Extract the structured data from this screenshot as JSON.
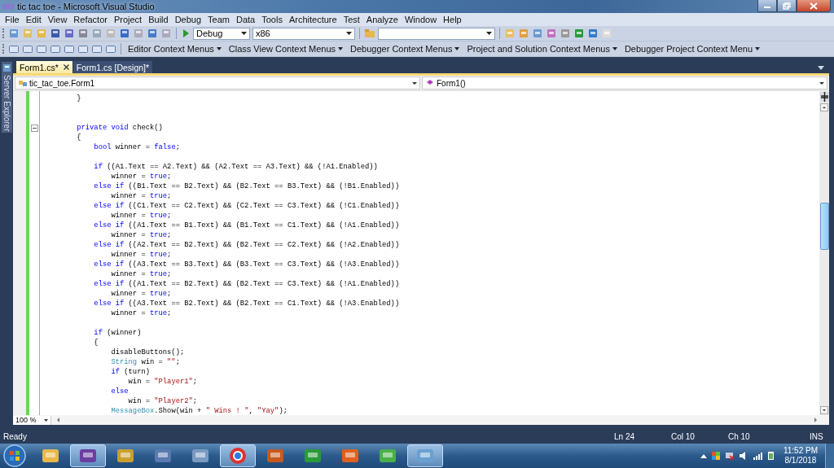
{
  "window": {
    "title": "tic tac toe - Microsoft Visual Studio"
  },
  "menu": [
    "File",
    "Edit",
    "View",
    "Refactor",
    "Project",
    "Build",
    "Debug",
    "Team",
    "Data",
    "Tools",
    "Architecture",
    "Test",
    "Analyze",
    "Window",
    "Help"
  ],
  "toolbar": {
    "configuration": "Debug",
    "platform": "x86"
  },
  "context_menus": [
    "Editor Context Menus",
    "Class View Context Menus",
    "Debugger Context Menus",
    "Project and Solution Context Menus",
    "Debugger Project Context Menu"
  ],
  "side_panel": {
    "label": "Server Explorer"
  },
  "tabs": [
    {
      "label": "Form1.cs*",
      "selected": true
    },
    {
      "label": "Form1.cs [Design]*",
      "selected": false
    }
  ],
  "navigation": {
    "type": "tic_tac_toe.Form1",
    "member": "Form1()"
  },
  "code": [
    {
      "kind": "code",
      "tokens": [
        {
          "kind": "plain",
          "text": "        }"
        }
      ]
    },
    {
      "kind": "blank"
    },
    {
      "kind": "blank"
    },
    {
      "kind": "block-start",
      "tokens": [
        {
          "kind": "keyword",
          "text": "        private void"
        },
        {
          "kind": "plain",
          "text": " check()"
        }
      ]
    },
    {
      "kind": "code",
      "tokens": [
        {
          "kind": "plain",
          "text": "        {"
        }
      ]
    },
    {
      "kind": "code",
      "tokens": [
        {
          "kind": "keyword",
          "text": "            bool"
        },
        {
          "kind": "plain",
          "text": " winner = "
        },
        {
          "kind": "keyword",
          "text": "false"
        },
        {
          "kind": "plain",
          "text": ";"
        }
      ]
    },
    {
      "kind": "blank"
    },
    {
      "kind": "code",
      "tokens": [
        {
          "kind": "keyword",
          "text": "            if"
        },
        {
          "kind": "plain",
          "text": " ((A1.Text == A2.Text) && (A2.Text == A3.Text) && (!A1.Enabled))"
        }
      ]
    },
    {
      "kind": "code",
      "tokens": [
        {
          "kind": "plain",
          "text": "                winner = "
        },
        {
          "kind": "keyword",
          "text": "true"
        },
        {
          "kind": "plain",
          "text": ";"
        }
      ]
    },
    {
      "kind": "code",
      "tokens": [
        {
          "kind": "keyword",
          "text": "            else if"
        },
        {
          "kind": "plain",
          "text": " ((B1.Text == B2.Text) && (B2.Text == B3.Text) && (!B1.Enabled))"
        }
      ]
    },
    {
      "kind": "code",
      "tokens": [
        {
          "kind": "plain",
          "text": "                winner = "
        },
        {
          "kind": "keyword",
          "text": "true"
        },
        {
          "kind": "plain",
          "text": ";"
        }
      ]
    },
    {
      "kind": "code",
      "tokens": [
        {
          "kind": "keyword",
          "text": "            else if"
        },
        {
          "kind": "plain",
          "text": " ((C1.Text == C2.Text) && (C2.Text == C3.Text) && (!C1.Enabled))"
        }
      ]
    },
    {
      "kind": "code",
      "tokens": [
        {
          "kind": "plain",
          "text": "                winner = "
        },
        {
          "kind": "keyword",
          "text": "true"
        },
        {
          "kind": "plain",
          "text": ";"
        }
      ]
    },
    {
      "kind": "code",
      "tokens": [
        {
          "kind": "keyword",
          "text": "            else if"
        },
        {
          "kind": "plain",
          "text": " ((A1.Text == B1.Text) && (B1.Text == C1.Text) && (!A1.Enabled))"
        }
      ]
    },
    {
      "kind": "code",
      "tokens": [
        {
          "kind": "plain",
          "text": "                winner = "
        },
        {
          "kind": "keyword",
          "text": "true"
        },
        {
          "kind": "plain",
          "text": ";"
        }
      ]
    },
    {
      "kind": "code",
      "tokens": [
        {
          "kind": "keyword",
          "text": "            else if"
        },
        {
          "kind": "plain",
          "text": " ((A2.Text == B2.Text) && (B2.Text == C2.Text) && (!A2.Enabled))"
        }
      ]
    },
    {
      "kind": "code",
      "tokens": [
        {
          "kind": "plain",
          "text": "                winner = "
        },
        {
          "kind": "keyword",
          "text": "true"
        },
        {
          "kind": "plain",
          "text": ";"
        }
      ]
    },
    {
      "kind": "code",
      "tokens": [
        {
          "kind": "keyword",
          "text": "            else if"
        },
        {
          "kind": "plain",
          "text": " ((A3.Text == B3.Text) && (B3.Text == C3.Text) && (!A3.Enabled))"
        }
      ]
    },
    {
      "kind": "code",
      "tokens": [
        {
          "kind": "plain",
          "text": "                winner = "
        },
        {
          "kind": "keyword",
          "text": "true"
        },
        {
          "kind": "plain",
          "text": ";"
        }
      ]
    },
    {
      "kind": "code",
      "tokens": [
        {
          "kind": "keyword",
          "text": "            else if"
        },
        {
          "kind": "plain",
          "text": " ((A1.Text == B2.Text) && (B2.Text == C3.Text) && (!A1.Enabled))"
        }
      ]
    },
    {
      "kind": "code",
      "tokens": [
        {
          "kind": "plain",
          "text": "                winner = "
        },
        {
          "kind": "keyword",
          "text": "true"
        },
        {
          "kind": "plain",
          "text": ";"
        }
      ]
    },
    {
      "kind": "code",
      "tokens": [
        {
          "kind": "keyword",
          "text": "            else if"
        },
        {
          "kind": "plain",
          "text": " ((A3.Text == B2.Text) && (B2.Text == C1.Text) && (!A3.Enabled))"
        }
      ]
    },
    {
      "kind": "code",
      "tokens": [
        {
          "kind": "plain",
          "text": "                winner = "
        },
        {
          "kind": "keyword",
          "text": "true"
        },
        {
          "kind": "plain",
          "text": ";"
        }
      ]
    },
    {
      "kind": "blank"
    },
    {
      "kind": "code",
      "tokens": [
        {
          "kind": "keyword",
          "text": "            if"
        },
        {
          "kind": "plain",
          "text": " (winner)"
        }
      ]
    },
    {
      "kind": "code",
      "tokens": [
        {
          "kind": "plain",
          "text": "            {"
        }
      ]
    },
    {
      "kind": "code",
      "tokens": [
        {
          "kind": "plain",
          "text": "                disableButtons();"
        }
      ]
    },
    {
      "kind": "code",
      "tokens": [
        {
          "kind": "type",
          "text": "                String"
        },
        {
          "kind": "plain",
          "text": " win = "
        },
        {
          "kind": "string",
          "text": "\"\""
        },
        {
          "kind": "plain",
          "text": ";"
        }
      ]
    },
    {
      "kind": "code",
      "tokens": [
        {
          "kind": "keyword",
          "text": "                if"
        },
        {
          "kind": "plain",
          "text": " (turn)"
        }
      ]
    },
    {
      "kind": "code",
      "tokens": [
        {
          "kind": "plain",
          "text": "                    win = "
        },
        {
          "kind": "string",
          "text": "\"Player1\""
        },
        {
          "kind": "plain",
          "text": ";"
        }
      ]
    },
    {
      "kind": "code",
      "tokens": [
        {
          "kind": "keyword",
          "text": "                else"
        }
      ]
    },
    {
      "kind": "code",
      "tokens": [
        {
          "kind": "plain",
          "text": "                    win = "
        },
        {
          "kind": "string",
          "text": "\"Player2\""
        },
        {
          "kind": "plain",
          "text": ";"
        }
      ]
    },
    {
      "kind": "code",
      "tokens": [
        {
          "kind": "type",
          "text": "                MessageBox"
        },
        {
          "kind": "plain",
          "text": ".Show(win + "
        },
        {
          "kind": "string",
          "text": "\" Wins ! \""
        },
        {
          "kind": "plain",
          "text": ", "
        },
        {
          "kind": "string",
          "text": "\"Yay\""
        },
        {
          "kind": "plain",
          "text": ");"
        }
      ]
    }
  ],
  "zoom": "100 %",
  "status_bar": {
    "message": "Ready",
    "line": "Ln 24",
    "column": "Col 10",
    "char": "Ch 10",
    "mode": "INS"
  },
  "taskbar": {
    "apps": [
      {
        "open": false
      },
      {
        "open": true
      },
      {
        "open": false
      },
      {
        "open": false
      },
      {
        "open": false
      },
      {
        "open": true
      },
      {
        "open": false
      },
      {
        "open": false
      },
      {
        "open": false
      },
      {
        "open": false
      },
      {
        "open": true
      }
    ],
    "time": "11:52 PM",
    "date": "8/1/2018"
  }
}
